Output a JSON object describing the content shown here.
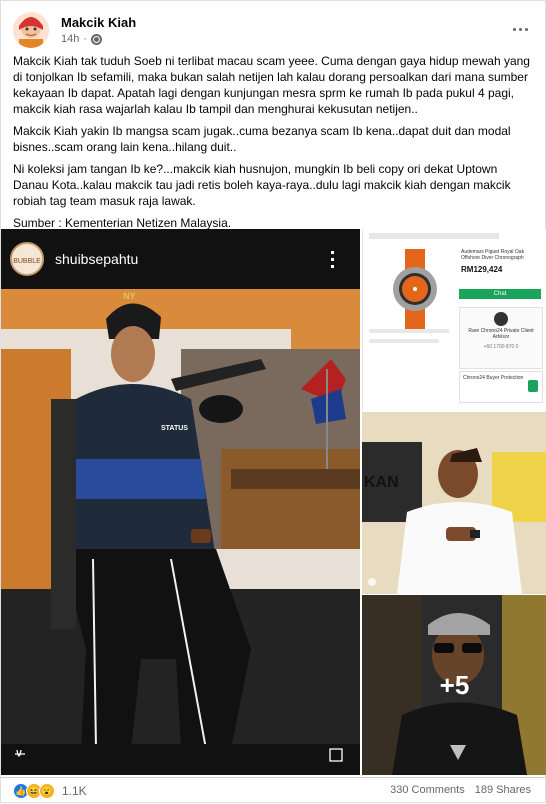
{
  "post": {
    "author": "Makcik Kiah",
    "timestamp": "14h",
    "visibility_icon": "globe-icon",
    "paragraphs": [
      "Makcik Kiah tak tuduh Soeb ni terlibat macau scam yeee. Cuma dengan gaya hidup mewah yang di tonjolkan Ib sefamili, maka bukan salah netijen lah kalau dorang persoalkan dari mana sumber kekayaan Ib dapat. Apatah lagi dengan kunjungan mesra sprm  ke rumah Ib pada pukul 4 pagi, makcik kiah rasa wajarlah kalau Ib tampil dan menghurai kekusutan netijen..",
      "Makcik Kiah yakin Ib mangsa scam jugak..cuma bezanya scam Ib kena..dapat duit dan modal bisnes..scam orang lain kena..hilang duit..",
      "Ni koleksi jam tangan Ib ke?...makcik kiah husnujon, mungkin Ib beli copy ori dekat Uptown Danau Kota..kalau makcik tau jadi retis boleh kaya-raya..dulu lagi makcik kiah dengan makcik robiah tag team masuk raja lawak.",
      "Sumber : Kementerian Netizen Malaysia."
    ]
  },
  "photos": {
    "main": {
      "username": "shuibsepahtu",
      "cap_text": "NY",
      "jacket_text": "STATUS"
    },
    "product": {
      "title": "Audemars Piguet Royal Oak Offshore Diver Chronograph",
      "price": "RM129,424",
      "cta": "Chat",
      "seller": "Rare Chrono24 Private Client Advisor",
      "seller_phone": "+60 1700 870 0",
      "buyer_protection": "Chrono24 Buyer Protection"
    },
    "promo_banner": "KAN",
    "more_count": "+5"
  },
  "footer": {
    "reaction_count": "1.1K",
    "comments": "330 Comments",
    "shares": "189 Shares"
  },
  "colors": {
    "brand_blue": "#1877f2",
    "text_secondary": "#65676b"
  }
}
